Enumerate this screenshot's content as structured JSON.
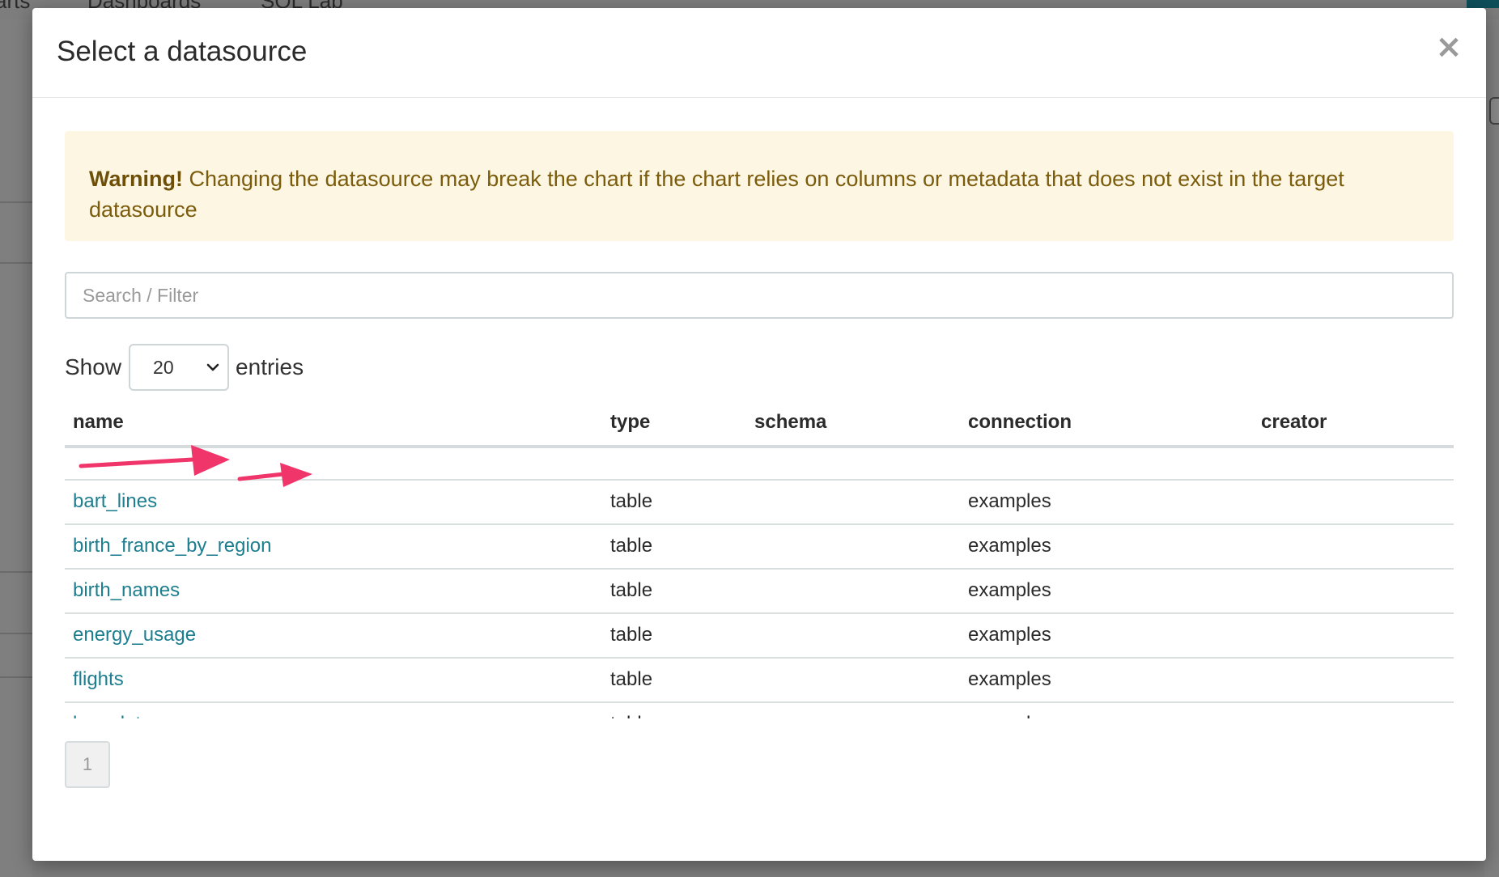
{
  "background": {
    "nav_items": [
      "arts",
      "Dashboards",
      "SQL Lab"
    ]
  },
  "modal": {
    "title": "Select a datasource",
    "close_glyph": "×",
    "warning": {
      "strong": "Warning!",
      "text": " Changing the datasource may break the chart if the chart relies on columns or metadata that does not exist in the target datasource"
    },
    "search": {
      "placeholder": "Search / Filter",
      "value": ""
    },
    "show_label": "Show",
    "page_size": "20",
    "entries_label": "entries",
    "columns": [
      "name",
      "type",
      "schema",
      "connection",
      "creator"
    ],
    "rows": [
      {
        "name": "bart_lines",
        "type": "table",
        "schema": "",
        "connection": "examples",
        "creator": ""
      },
      {
        "name": "birth_france_by_region",
        "type": "table",
        "schema": "",
        "connection": "examples",
        "creator": ""
      },
      {
        "name": "birth_names",
        "type": "table",
        "schema": "",
        "connection": "examples",
        "creator": ""
      },
      {
        "name": "energy_usage",
        "type": "table",
        "schema": "",
        "connection": "examples",
        "creator": ""
      },
      {
        "name": "flights",
        "type": "table",
        "schema": "",
        "connection": "examples",
        "creator": ""
      },
      {
        "name": "long_lat",
        "type": "table",
        "schema": "",
        "connection": "examples",
        "creator": ""
      }
    ],
    "pagination": {
      "current_page": "1"
    },
    "annotation_color": "#f0356b",
    "link_color": "#1d7e8f",
    "warning_bg": "#fcf6e2"
  }
}
